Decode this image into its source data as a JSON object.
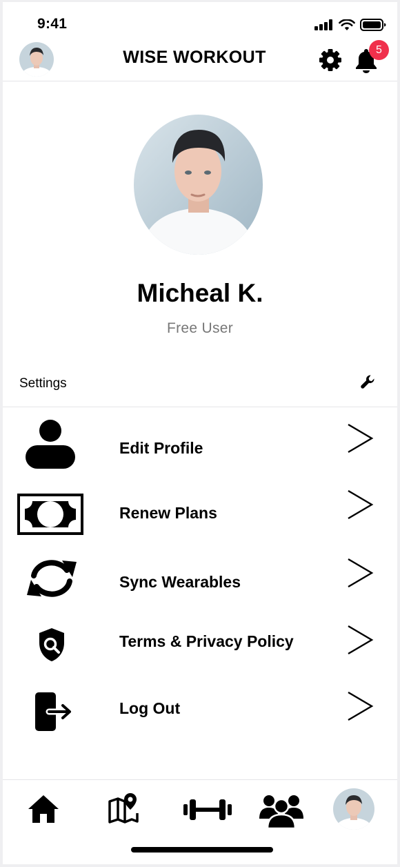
{
  "status_bar": {
    "time": "9:41"
  },
  "header": {
    "title": "WISE WORKOUT",
    "notification_count": "5"
  },
  "profile": {
    "name": "Micheal K.",
    "status": "Free User"
  },
  "settings": {
    "label": "Settings"
  },
  "menu": {
    "items": [
      {
        "label": "Edit Profile",
        "icon": "person-icon"
      },
      {
        "label": "Renew Plans",
        "icon": "cash-icon"
      },
      {
        "label": "Sync Wearables",
        "icon": "sync-icon"
      },
      {
        "label": "Terms & Privacy Policy",
        "icon": "shield-search-icon"
      },
      {
        "label": "Log Out",
        "icon": "logout-icon"
      }
    ]
  },
  "tab_bar": {
    "items": [
      "home-icon",
      "map-pin-icon",
      "dumbbell-icon",
      "community-icon",
      "profile-avatar"
    ]
  },
  "colors": {
    "badge": "#f0304c",
    "muted_text": "#777777",
    "divider": "#e4e4e8"
  }
}
